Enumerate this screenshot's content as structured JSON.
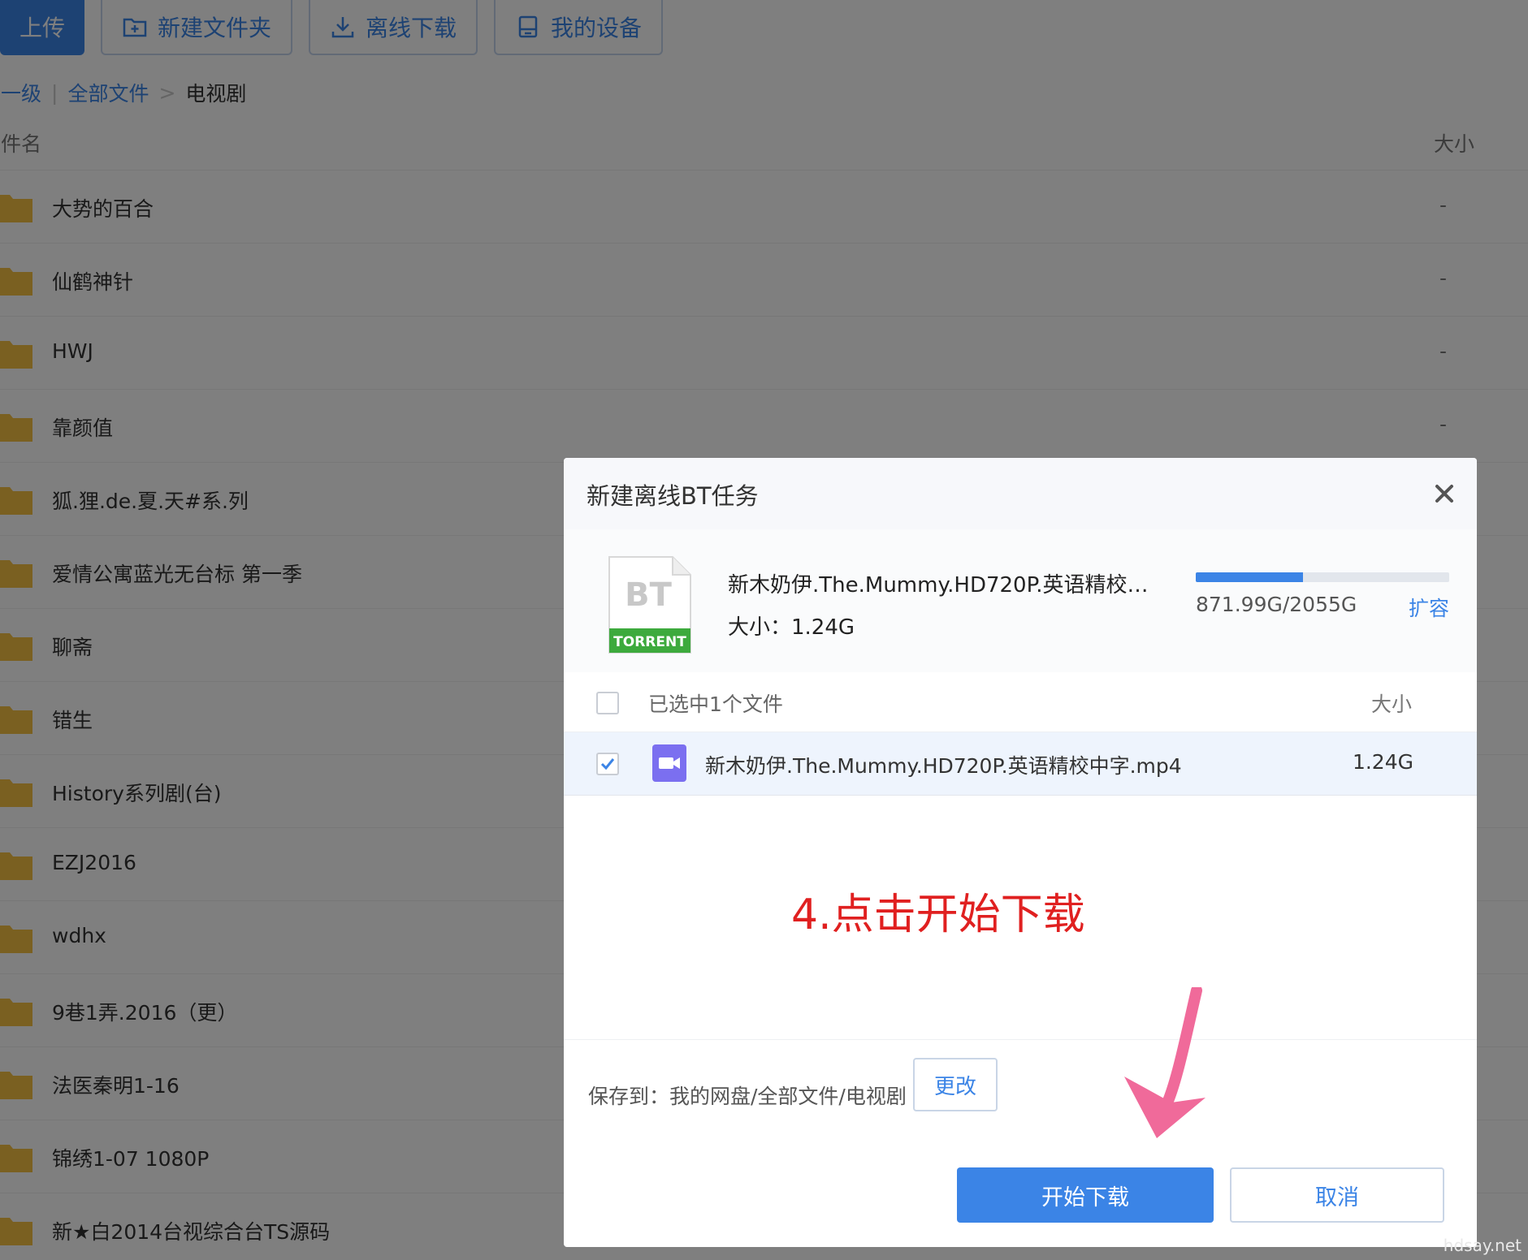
{
  "toolbar": {
    "upload_label": "上传",
    "new_folder_label": "新建文件夹",
    "offline_download_label": "离线下载",
    "my_devices_label": "我的设备"
  },
  "breadcrumb": {
    "up_level": "上一级",
    "all_files": "全部文件",
    "separator": ">",
    "current": "电视剧"
  },
  "file_list": {
    "col_name": "文件名",
    "col_size": "大小",
    "rows": [
      {
        "name": "大势的百合",
        "size": "-"
      },
      {
        "name": "仙鹤神针",
        "size": "-"
      },
      {
        "name": "HWJ",
        "size": "-"
      },
      {
        "name": "靠颜值",
        "size": "-"
      },
      {
        "name": "狐.狸.de.夏.天#系.列",
        "size": ""
      },
      {
        "name": "爱情公寓蓝光无台标 第一季",
        "size": ""
      },
      {
        "name": "聊斋",
        "size": ""
      },
      {
        "name": "错生",
        "size": ""
      },
      {
        "name": "History系列剧(台)",
        "size": ""
      },
      {
        "name": "EZJ2016",
        "size": ""
      },
      {
        "name": "wdhx",
        "size": ""
      },
      {
        "name": "9巷1弄.2016（更）",
        "size": ""
      },
      {
        "name": "法医秦明1-16",
        "size": ""
      },
      {
        "name": "锦绣1-07 1080P",
        "size": ""
      },
      {
        "name": "新★白2014台视综合台TS源码",
        "size": ""
      }
    ]
  },
  "dialog": {
    "title": "新建离线BT任务",
    "torrent": {
      "icon_text_top": "BT",
      "icon_text_bottom": "TORRENT",
      "name": "新木奶伊.The.Mummy.HD720P.英语精校中字...",
      "size_label": "大小：1.24G"
    },
    "quota": {
      "text": "871.99G/2055G",
      "used_fraction": 0.424,
      "expand_label": "扩容"
    },
    "selection": {
      "label": "已选中1个文件",
      "size_header": "大小"
    },
    "files": [
      {
        "name": "新木奶伊.The.Mummy.HD720P.英语精校中字.mp4",
        "size": "1.24G",
        "checked": true
      }
    ],
    "annotation": "4.点击开始下载",
    "save_to_label": "保存到：我的网盘/全部文件/电视剧",
    "change_label": "更改",
    "start_label": "开始下载",
    "cancel_label": "取消"
  },
  "watermark": "hdsay.net",
  "colors": {
    "accent": "#3b84e6",
    "annotation": "#e02020",
    "arrow": "#f06a9a",
    "folder": "#f5c042",
    "torrent_green": "#3daa3d",
    "video_purple": "#7b6ff0"
  }
}
